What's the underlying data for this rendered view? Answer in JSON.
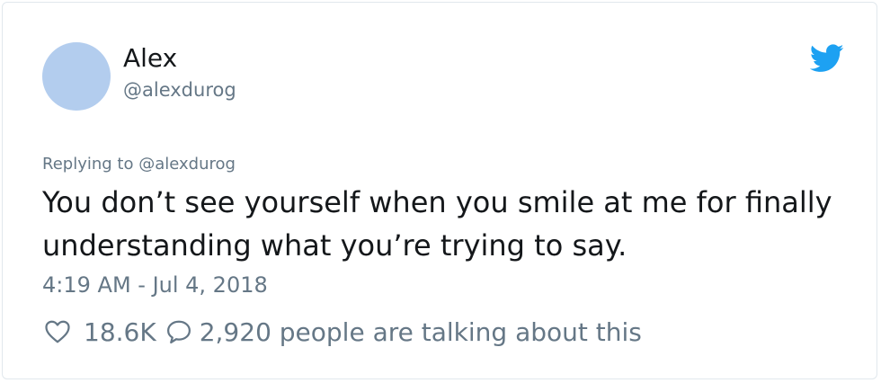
{
  "tweet": {
    "display_name": "Alex",
    "handle": "@alexdurog",
    "reply_to": "Replying to @alexdurog",
    "text": "You don’t see yourself when you smile at me for finally understanding what you’re trying to say.",
    "timestamp": "4:19 AM - Jul 4, 2018",
    "likes": "18.6K",
    "talking": "2,920 people are talking about this"
  },
  "icons": {
    "brand": "twitter-bird-icon",
    "like": "heart-outline-icon",
    "reply": "speech-bubble-icon"
  },
  "colors": {
    "avatar": "#b3cdee",
    "brand": "#1da1f2",
    "secondary_text": "#657786",
    "primary_text": "#14171a"
  }
}
